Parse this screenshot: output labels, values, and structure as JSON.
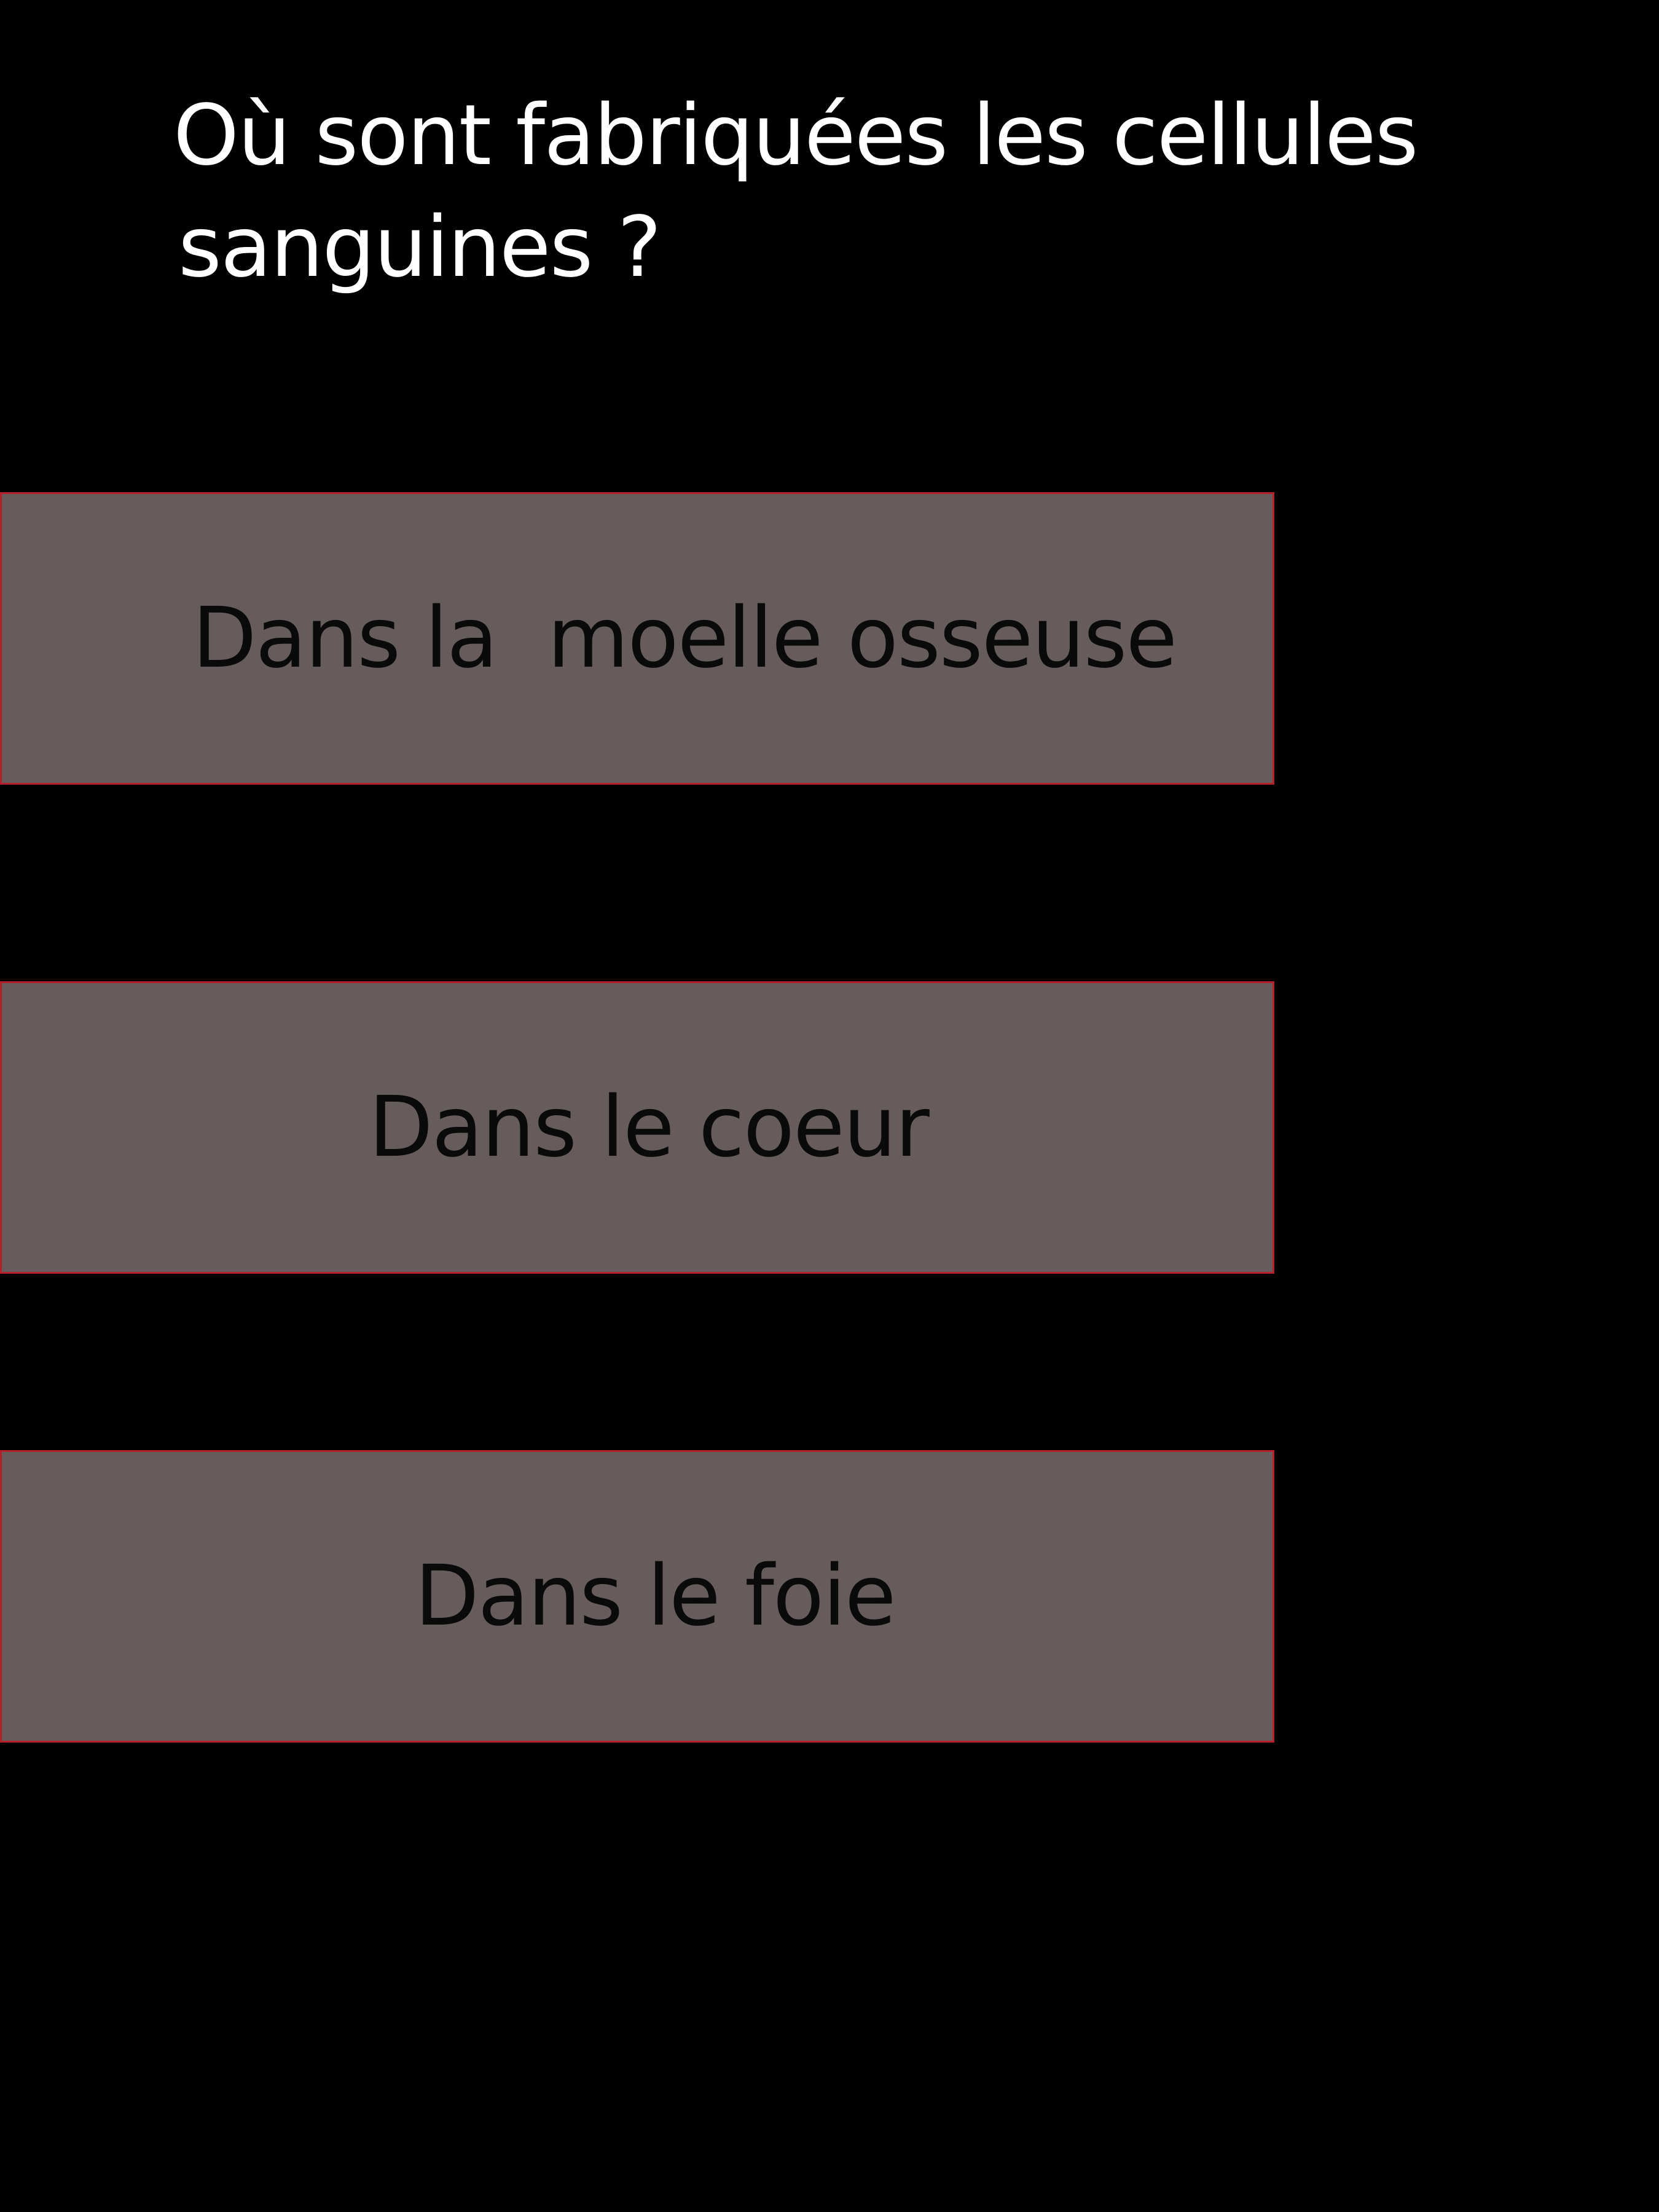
{
  "question": {
    "line1": "Où sont fabriquées les cellules",
    "line2": "sanguines ?"
  },
  "answers": [
    {
      "label": "Dans la  moelle osseuse"
    },
    {
      "label": "Dans le coeur"
    },
    {
      "label": "Dans le foie"
    }
  ],
  "colors": {
    "background": "#000000",
    "question_text": "#ffffff",
    "answer_fill": "#675c5c",
    "answer_border": "#b5202a",
    "answer_text": "#0a0a0a"
  }
}
